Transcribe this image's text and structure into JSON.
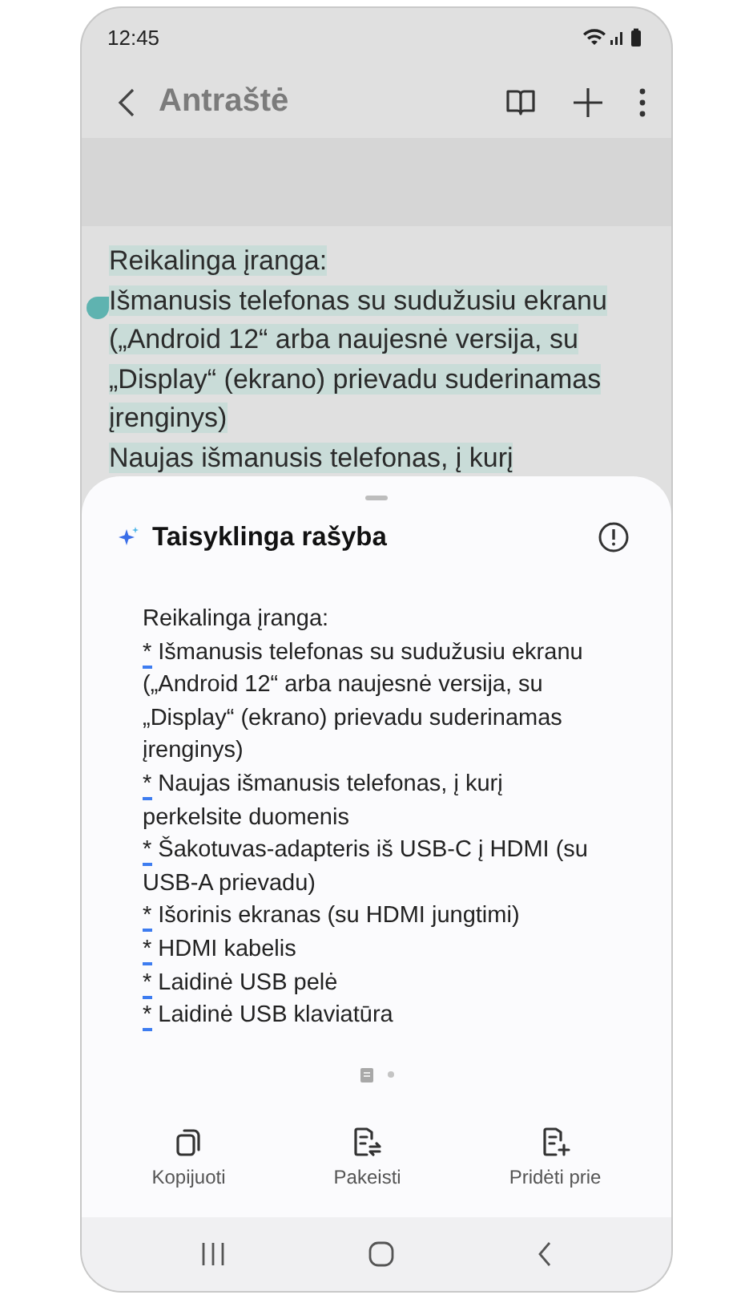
{
  "status_bar": {
    "time": "12:45"
  },
  "toolbar": {
    "title": "Antraštė"
  },
  "note": {
    "selected": true,
    "paragraphs": [
      "Reikalinga įranga:",
      "Išmanusis telefonas su sudužusiu ekranu („Android 12“ arba naujesnė versija, su „Display“ (ekrano) prievadu suderinamas įrenginys)",
      "Naujas išmanusis telefonas, į kurį"
    ]
  },
  "sheet": {
    "title": "Taisyklinga rašyba",
    "heading": "Reikalinga įranga:",
    "items": [
      {
        "marker": "*",
        "corrected": true,
        "text": "Išmanusis telefonas su sudužusiu ekranu („Android 12“ arba naujesnė versija, su „Display“ (ekrano) prievadu suderinamas įrenginys)"
      },
      {
        "marker": "*",
        "corrected": true,
        "text": "Naujas išmanusis telefonas, į kurį perkelsite duomenis"
      },
      {
        "marker": "*",
        "corrected": true,
        "text": "Šakotuvas-adapteris iš USB-C į HDMI (su USB-A prievadu)"
      },
      {
        "marker": "*",
        "corrected": true,
        "text": "Išorinis ekranas (su HDMI jungtimi)"
      },
      {
        "marker": "*",
        "corrected": true,
        "text": "HDMI kabelis"
      },
      {
        "marker": "*",
        "corrected": true,
        "text": "Laidinė USB pelė"
      },
      {
        "marker": "*",
        "corrected": true,
        "text": "Laidinė USB klaviatūra"
      }
    ],
    "pages": [
      {
        "kind": "doc",
        "selected": true
      },
      {
        "kind": "dot",
        "selected": false
      }
    ],
    "actions": [
      {
        "kind": "copy",
        "label": "Kopijuoti"
      },
      {
        "kind": "replace",
        "label": "Pakeisti"
      },
      {
        "kind": "add",
        "label": "Pridėti prie"
      }
    ]
  }
}
